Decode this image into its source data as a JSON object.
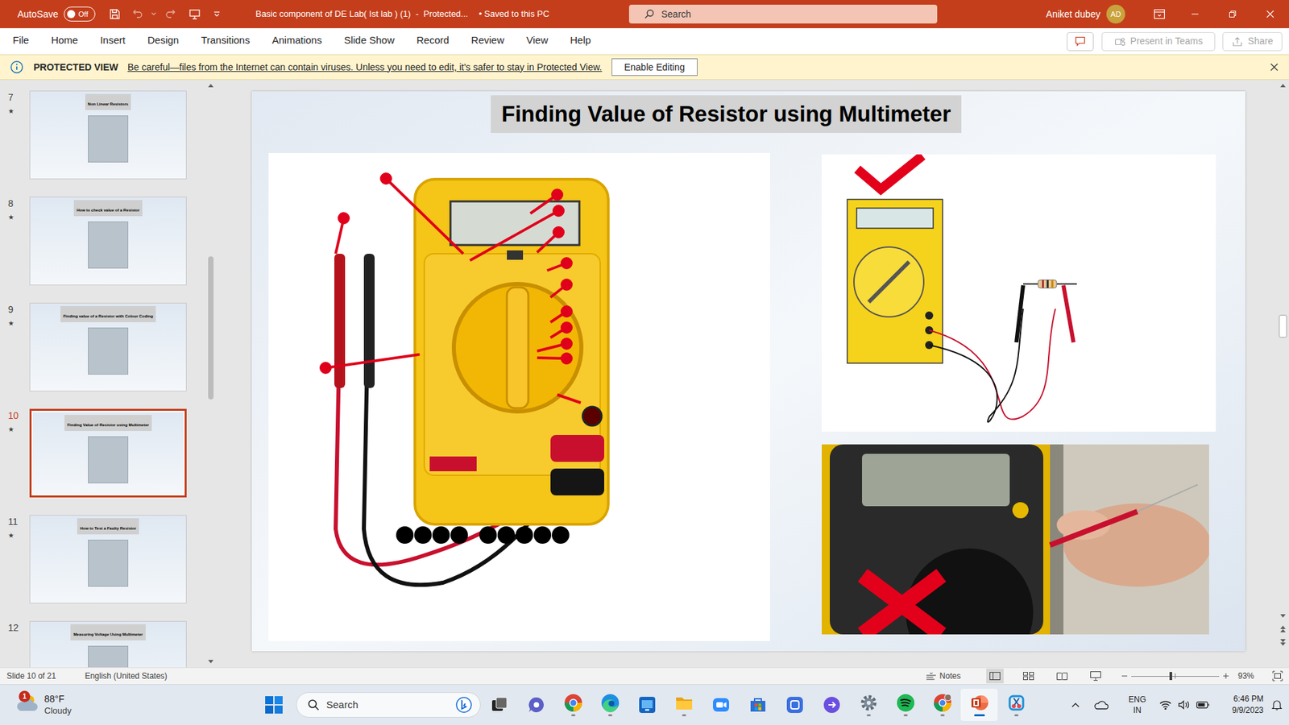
{
  "window": {
    "autosave": {
      "label": "AutoSave",
      "state": "Off",
      "on": false
    },
    "title": "Basic component of DE Lab( Ist lab ) (1)  -  Protected...",
    "save_status": "• Saved to this PC",
    "search": {
      "placeholder": "Search"
    },
    "user": {
      "name": "Aniket dubey",
      "initials": "AD"
    }
  },
  "menu": [
    {
      "label": "File",
      "selected": false
    },
    {
      "label": "Home",
      "selected": false
    },
    {
      "label": "Insert",
      "selected": false
    },
    {
      "label": "Design",
      "selected": false
    },
    {
      "label": "Transitions",
      "selected": false
    },
    {
      "label": "Animations",
      "selected": false
    },
    {
      "label": "Slide Show",
      "selected": false
    },
    {
      "label": "Record",
      "selected": false
    },
    {
      "label": "Review",
      "selected": false
    },
    {
      "label": "View",
      "selected": false
    },
    {
      "label": "Help",
      "selected": false
    }
  ],
  "menu_buttons": [
    {
      "label": "Present in Teams",
      "disabled": true
    },
    {
      "label": "Share",
      "disabled": true
    }
  ],
  "protected_view": {
    "title": "PROTECTED VIEW",
    "message": "Be careful—files from the Internet can contain viruses. Unless you need to edit, it's safer to stay in Protected View.",
    "button": "Enable Editing"
  },
  "thumbnails": [
    {
      "number": "7",
      "star": "★",
      "title": "Non Linear Resistors",
      "selected": false
    },
    {
      "number": "8",
      "star": "★",
      "title": "How to check value of a Resistor",
      "selected": false
    },
    {
      "number": "9",
      "star": "★",
      "title": "Finding value of a Resistor with Colour Coding",
      "selected": false
    },
    {
      "number": "10",
      "star": "★",
      "title": "Finding Value of Resistor using Multimeter",
      "selected": true
    },
    {
      "number": "11",
      "star": "★",
      "title": "How to Test a Faulty Resistor",
      "selected": false
    },
    {
      "number": "12",
      "star": "",
      "title": "Measuring Voltage Using Multimeter",
      "selected": false
    }
  ],
  "slide": {
    "title": "Finding Value of Resistor using Multimeter"
  },
  "status_bar": {
    "slide": "Slide 10 of 21",
    "language": "English (United States)",
    "notes": "Notes",
    "zoom": "93%",
    "zoom_level": 0.45
  },
  "taskbar": {
    "weather": {
      "temperature": "88°F",
      "condition": "Cloudy",
      "badge": "1"
    },
    "search": {
      "placeholder": "Search"
    },
    "input_language": "ENG",
    "region": "IN",
    "time": "6:46 PM",
    "date": "9/9/2023"
  }
}
